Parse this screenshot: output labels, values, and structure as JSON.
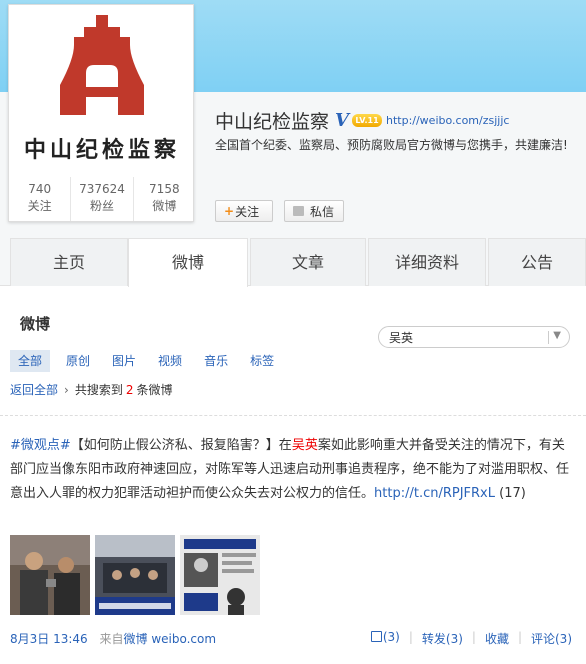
{
  "profile": {
    "avatar_text": "中山纪检监察",
    "name": "中山纪检监察",
    "verified_mark": "V",
    "level_badge": "LV.11",
    "url": "http://weibo.com/zsjjjc",
    "bio": "全国首个纪委、监察局、预防腐败局官方微博与您携手，共建廉洁!",
    "stats": [
      {
        "value": "740",
        "label": "关注"
      },
      {
        "value": "737624",
        "label": "粉丝"
      },
      {
        "value": "7158",
        "label": "微博"
      }
    ],
    "follow_label": "关注",
    "message_label": "私信"
  },
  "tabs": [
    "主页",
    "微博",
    "文章",
    "详细资料",
    "公告"
  ],
  "active_tab": "微博",
  "section": {
    "title": "微博",
    "search_value": "吴英"
  },
  "filters": [
    "全部",
    "原创",
    "图片",
    "视频",
    "音乐",
    "标签"
  ],
  "results": {
    "back_label": "返回全部",
    "prefix": "共搜索到",
    "count": "2",
    "suffix": "条微博"
  },
  "post": {
    "hashtag": "#微观点#",
    "text_1": "【如何防止假公济私、报复陷害？】在",
    "highlight": "吴英",
    "text_2": "案如此影响重大并备受关注的情况下，有关部门应当像东阳市政府神速回应，对陈军等人迅速启动刑事追责程序，绝不能为了对滥用职权、任意出入人罪的权力犯罪活动袒护而使公众失去对公权力的信任。",
    "link": "http://t.cn/RPJFRxL",
    "link_count": "(17)",
    "images": [
      "photo-1",
      "photo-2",
      "photo-3"
    ],
    "time": "8月3日 13:46",
    "source_prefix": "来自",
    "source_name": "微博 weibo.com",
    "likes": "(3)",
    "repost": "转发(3)",
    "favorite": "收藏",
    "comment": "评论(3)"
  },
  "colors": {
    "link": "#2a63b8",
    "highlight": "#e00000",
    "banner": "#7fd0f4",
    "logo_red": "#c0392b"
  }
}
